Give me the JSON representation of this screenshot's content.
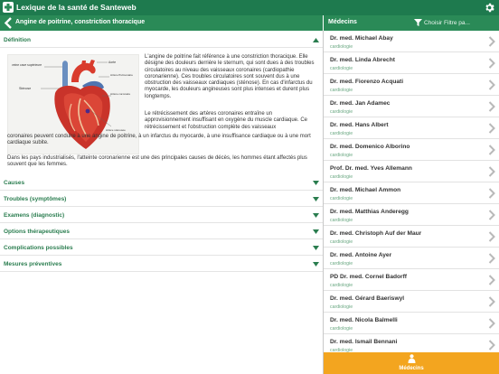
{
  "app": {
    "title": "Lexique de la santé de Santeweb"
  },
  "topic": {
    "title": "Angine de poitrine, constriction thoracique"
  },
  "definition": {
    "label": "Définition",
    "image_labels": {
      "vena_cava": "veine cave supérieure",
      "aorta": "Aorte",
      "pulmonary_artery": "Artère Pulmonaire",
      "coronary_arteries": "Artère coronaire",
      "stenosis": "Sténose",
      "ischemia": "Artère sténosée"
    },
    "p1": "L'angine de poitrine fait référence à une constriction thoracique. Elle désigne des douleurs derrière le sternum, qui sont dues à des troubles circulatoires au niveau des vaisseaux coronaires (cardiopathie coronarienne). Ces troubles circulatoires sont souvent dus à une obstruction des vaisseaux cardiaques (sténose). En cas d'infarctus du myocarde, les douleurs angineuses sont plus intenses et durent plus longtemps.",
    "p2a": "Le rétrécissement des artères coronaires entraîne un approvisionnement insuffisant en oxygène du muscle cardiaque. Ce rétrécissement et l'obstruction complète des vaisseaux",
    "p2b": "coronaires peuvent conduire à une angine de poitrine, à un infarctus du myocarde, à une insuffisance cardiaque ou à une mort cardiaque subite.",
    "p3": "Dans les pays industrialisés, l'atteinte coronarienne est une des principales causes de décès, les hommes étant affectés plus souvent que les femmes."
  },
  "sections": [
    {
      "label": "Causes"
    },
    {
      "label": "Troubles (symptômes)"
    },
    {
      "label": "Examens (diagnostic)"
    },
    {
      "label": "Options thérapeutiques"
    },
    {
      "label": "Complications possibles"
    },
    {
      "label": "Mesures préventives"
    }
  ],
  "doctors_panel": {
    "title": "Médecins",
    "filter_label": "Choisir Filtre pa..."
  },
  "doctors": [
    {
      "name": "Dr. med. Michael Abay",
      "specialty": "cardiologie"
    },
    {
      "name": "Dr. med. Linda Abrecht",
      "specialty": "cardiologie"
    },
    {
      "name": "Dr. med. Fiorenzo Acquati",
      "specialty": "cardiologie"
    },
    {
      "name": "Dr. med. Jan Adamec",
      "specialty": "cardiologie"
    },
    {
      "name": "Dr. med. Hans Albert",
      "specialty": "cardiologie"
    },
    {
      "name": "Dr. med. Domenico Alborino",
      "specialty": "cardiologie"
    },
    {
      "name": "Prof. Dr. med. Yves Allemann",
      "specialty": "cardiologie"
    },
    {
      "name": "Dr. med. Michael Ammon",
      "specialty": "cardiologie"
    },
    {
      "name": "Dr. med. Matthias Anderegg",
      "specialty": "cardiologie"
    },
    {
      "name": "Dr. med. Christoph Auf der Maur",
      "specialty": "cardiologie"
    },
    {
      "name": "Dr. med. Antoine Ayer",
      "specialty": "cardiologie"
    },
    {
      "name": "PD Dr. med. Cornel Badorff",
      "specialty": "cardiologie"
    },
    {
      "name": "Dr. med. Gérard Baeriswyl",
      "specialty": "cardiologie"
    },
    {
      "name": "Dr. med. Nicola Balmelli",
      "specialty": "cardiologie"
    },
    {
      "name": "Dr. med. Ismail Bennani",
      "specialty": "cardiologie"
    }
  ],
  "tabbar": {
    "label": "Médecins"
  },
  "colors": {
    "header_dark": "#1e7a4e",
    "header": "#2a8a57",
    "accent_green": "#2a7d4f",
    "tab_orange": "#f3a51f"
  }
}
